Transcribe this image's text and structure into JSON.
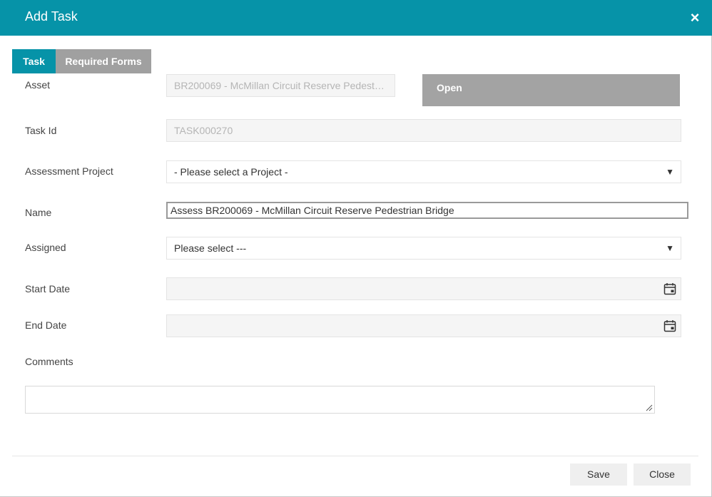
{
  "dialog": {
    "title": "Add Task",
    "close_glyph": "×"
  },
  "tabs": [
    {
      "label": "Task",
      "active": true
    },
    {
      "label": "Required Forms",
      "active": false
    }
  ],
  "form": {
    "asset": {
      "label": "Asset",
      "value": "BR200069 - McMillan Circuit Reserve Pedestrian Bridge"
    },
    "status": {
      "value": "Open"
    },
    "task_id": {
      "label": "Task Id",
      "value": "TASK000270"
    },
    "assessment_project": {
      "label": "Assessment Project",
      "selected": "- Please select a Project -"
    },
    "name": {
      "label": "Name",
      "value": "Assess BR200069 - McMillan Circuit Reserve Pedestrian Bridge"
    },
    "assigned": {
      "label": "Assigned",
      "selected": "Please select ---"
    },
    "start_date": {
      "label": "Start Date",
      "value": ""
    },
    "end_date": {
      "label": "End Date",
      "value": ""
    },
    "comments": {
      "label": "Comments",
      "value": ""
    }
  },
  "icons": {
    "dropdown": "chevron-down-icon",
    "calendar": "calendar-icon",
    "close": "close-icon",
    "resize": "resize-handle-icon"
  },
  "footer": {
    "save_label": "Save",
    "close_label": "Close"
  },
  "colors": {
    "accent": "#0693a8",
    "inactive_tab": "#a0a0a0",
    "status_box": "#a3a3a3",
    "button_bg": "#efefef"
  }
}
